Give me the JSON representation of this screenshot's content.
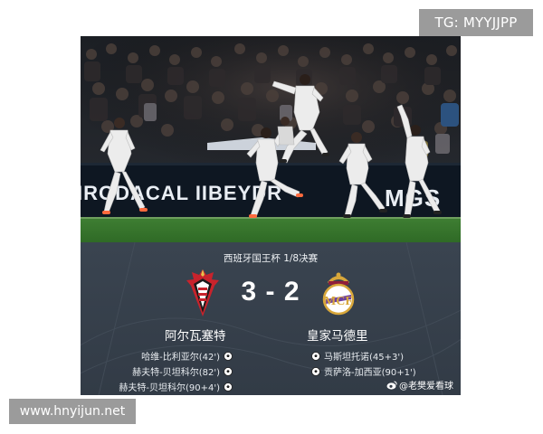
{
  "watermark_top": "TG: MYYJJPP",
  "watermark_bottom": "www.hnyijun.net",
  "photo": {
    "ad_board_text": "IRODACAL IIBEYDR",
    "ad_board_text_right": "MGS"
  },
  "match": {
    "competition": "西班牙国王杯 1/8决赛",
    "score": "3 - 2",
    "home": {
      "name": "阿尔瓦塞特",
      "crest_icon": "albacete-crest-icon",
      "scorers": [
        "哈维-比利亚尔(42')",
        "赫夫特-贝坦科尔(82')",
        "赫夫特-贝坦科尔(90+4')"
      ]
    },
    "away": {
      "name": "皇家马德里",
      "crest_icon": "real-madrid-crest-icon",
      "scorers": [
        "马斯坦托诺(45+3')",
        "贡萨洛-加西亚(90+1')"
      ]
    }
  },
  "credit": "@老樊爱看球",
  "colors": {
    "board_bg": "#343d48",
    "pitch": "#3b7a2e",
    "kit": "#eeeeee",
    "madrid_gold": "#d8a73a",
    "albacete_red": "#c8232c"
  }
}
